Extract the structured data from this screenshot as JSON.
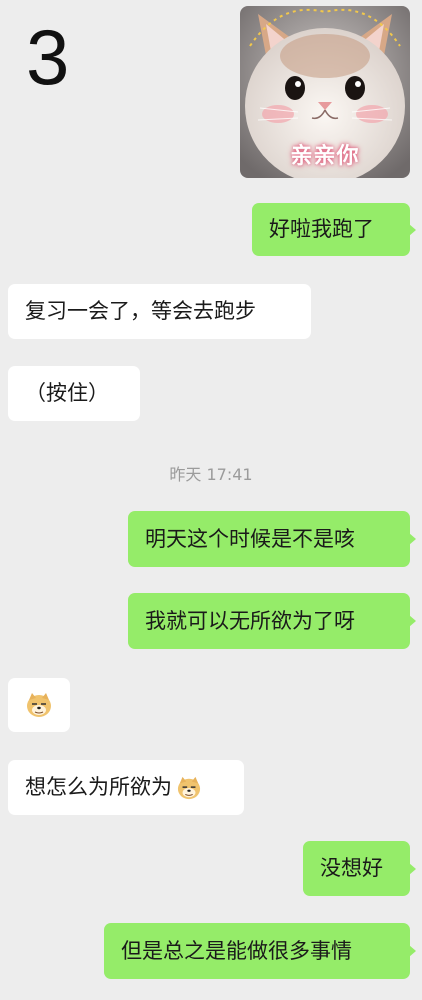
{
  "page_number": "3",
  "sticker": {
    "caption": "亲亲你",
    "icon": "cat-photo-sticker"
  },
  "messages": [
    {
      "side": "out",
      "text": "好啦我跑了"
    },
    {
      "side": "in",
      "text": "复习一会了，等会去跑步"
    },
    {
      "side": "in",
      "text": "（按住）"
    },
    {
      "side": "out",
      "text": "明天这个时候是不是咳"
    },
    {
      "side": "out",
      "text": "我就可以无所欲为了呀"
    },
    {
      "side": "in",
      "emoji": "doge-emoji"
    },
    {
      "side": "in",
      "text": "想怎么为所欲为",
      "emoji": "doge-emoji"
    },
    {
      "side": "out",
      "text": "没想好"
    },
    {
      "side": "out",
      "text": "但是总之是能做很多事情"
    }
  ],
  "timestamp": "昨天 17:41",
  "colors": {
    "background": "#ededed",
    "outgoing_bubble": "#95ec69",
    "incoming_bubble": "#ffffff",
    "timestamp_text": "#9b9b9b"
  }
}
